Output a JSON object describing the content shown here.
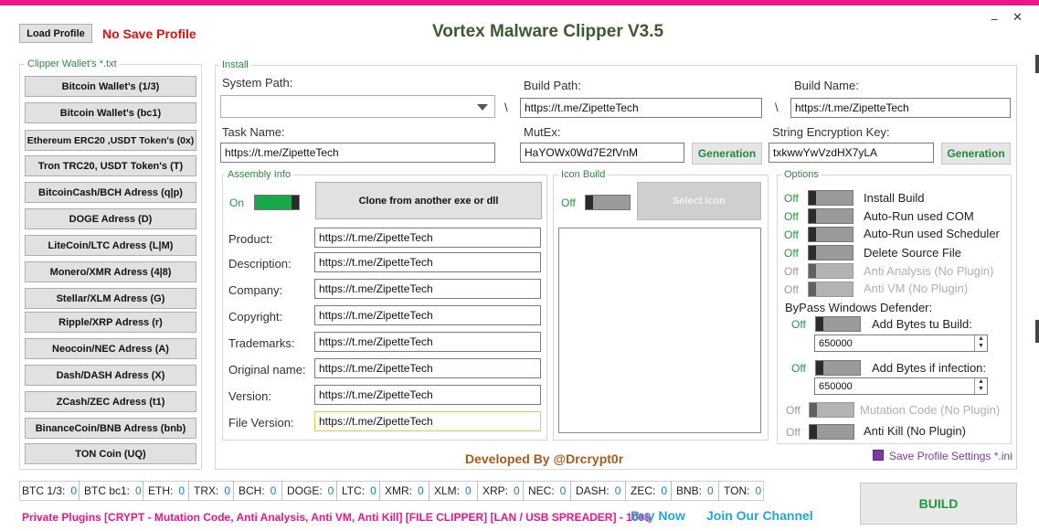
{
  "window": {
    "title": "Vortex Malware Clipper V3.5",
    "minimize_glyph": "_",
    "close_glyph": "✕",
    "accent_color": "#e8188a"
  },
  "header": {
    "load_profile": "Load Profile",
    "no_save_profile": "No Save Profile"
  },
  "wallets": {
    "title": "Clipper Wallet's *.txt",
    "items": [
      "Bitcoin Wallet's (1/3)",
      "Bitcoin Wallet's (bc1)",
      "Ethereum ERC20 ,USDT Token's (0x)",
      "Tron TRC20, USDT Token's (T)",
      "BitcoinCash/BCH Adress (q|p)",
      "DOGE Adress (D)",
      "LiteCoin/LTC Adress (L|M)",
      "Monero/XMR Adress (4|8)",
      "Stellar/XLM Adress (G)",
      "Ripple/XRP Adress (r)",
      "Neocoin/NEC Adress (A)",
      "Dash/DASH Adress (X)",
      "ZCash/ZEC Adress (t1)",
      "BinanceCoin/BNB Adress (bnb)",
      "TON Coin (UQ)"
    ]
  },
  "install": {
    "title": "Install",
    "system_path_label": "System Path:",
    "system_path_value": "",
    "backslash": "\\",
    "build_path_label": "Build Path:",
    "build_path_value": "https://t.me/ZipetteTech",
    "build_name_label": "Build Name:",
    "build_name_value": "https://t.me/ZipetteTech",
    "task_name_label": "Task Name:",
    "task_name_value": "https://t.me/ZipetteTech",
    "mutex_label": "MutEx:",
    "mutex_value": "HaYOWx0Wd7E2fVnM",
    "generation": "Generation",
    "string_key_label": "String Encryption Key:",
    "string_key_value": "txkwwYwVzdHX7yLA"
  },
  "assembly": {
    "title": "Assembly Info",
    "on_label": "On",
    "clone_button": "Clone from another exe or dll",
    "fields": [
      {
        "label": "Product:",
        "value": "https://t.me/ZipetteTech"
      },
      {
        "label": "Description:",
        "value": "https://t.me/ZipetteTech"
      },
      {
        "label": "Company:",
        "value": "https://t.me/ZipetteTech"
      },
      {
        "label": "Copyright:",
        "value": "https://t.me/ZipetteTech"
      },
      {
        "label": "Trademarks:",
        "value": "https://t.me/ZipetteTech"
      },
      {
        "label": "Original name:",
        "value": "https://t.me/ZipetteTech"
      },
      {
        "label": "Version:",
        "value": "https://t.me/ZipetteTech"
      },
      {
        "label": "File Version:",
        "value": "https://t.me/ZipetteTech"
      }
    ]
  },
  "icon_build": {
    "title": "Icon Build",
    "off_label": "Off",
    "select_icon": "Select icon"
  },
  "options": {
    "title": "Options",
    "off": "Off",
    "items": [
      {
        "label": "Install Build",
        "enabled": true
      },
      {
        "label": "Auto-Run used COM",
        "enabled": true
      },
      {
        "label": "Auto-Run used Scheduler",
        "enabled": true
      },
      {
        "label": "Delete Source File",
        "enabled": true
      },
      {
        "label": "Anti Analysis (No Plugin)",
        "enabled": false
      },
      {
        "label": "Anti VM (No Plugin)",
        "enabled": false
      }
    ],
    "bypass_label": "ByPass Windows Defender:",
    "add_bytes_build_label": "Add Bytes tu Build:",
    "add_bytes_build_value": "650000",
    "add_bytes_infection_label": "Add Bytes if infection:",
    "add_bytes_infection_value": "650000",
    "mutation_label": "Mutation Code (No Plugin)",
    "anti_kill_label": "Anti Kill (No Plugin)"
  },
  "footer": {
    "developed_by": "Developed By @Drcrypt0r",
    "save_profile": "Save Profile Settings *.ini",
    "counters": [
      {
        "label": "BTC 1/3:",
        "value": "0"
      },
      {
        "label": "BTC bc1:",
        "value": "0"
      },
      {
        "label": "ETH:",
        "value": "0"
      },
      {
        "label": "TRX:",
        "value": "0"
      },
      {
        "label": "BCH:",
        "value": "0"
      },
      {
        "label": "DOGE:",
        "value": "0"
      },
      {
        "label": "LTC:",
        "value": "0"
      },
      {
        "label": "XMR:",
        "value": "0"
      },
      {
        "label": "XLM:",
        "value": "0"
      },
      {
        "label": "XRP:",
        "value": "0"
      },
      {
        "label": "NEC:",
        "value": "0"
      },
      {
        "label": "DASH:",
        "value": "0"
      },
      {
        "label": "ZEC:",
        "value": "0"
      },
      {
        "label": "BNB:",
        "value": "0"
      },
      {
        "label": "TON:",
        "value": "0"
      }
    ],
    "private_plugins": "Private Plugins [CRYPT - Mutation Code, Anti Analysis, Anti VM, Anti Kill] [FILE CLIPPER] [LAN / USB SPREADER] - 100$",
    "buy_now": "Buy Now",
    "join_channel": "Join Our Channel",
    "build": "BUILD"
  }
}
